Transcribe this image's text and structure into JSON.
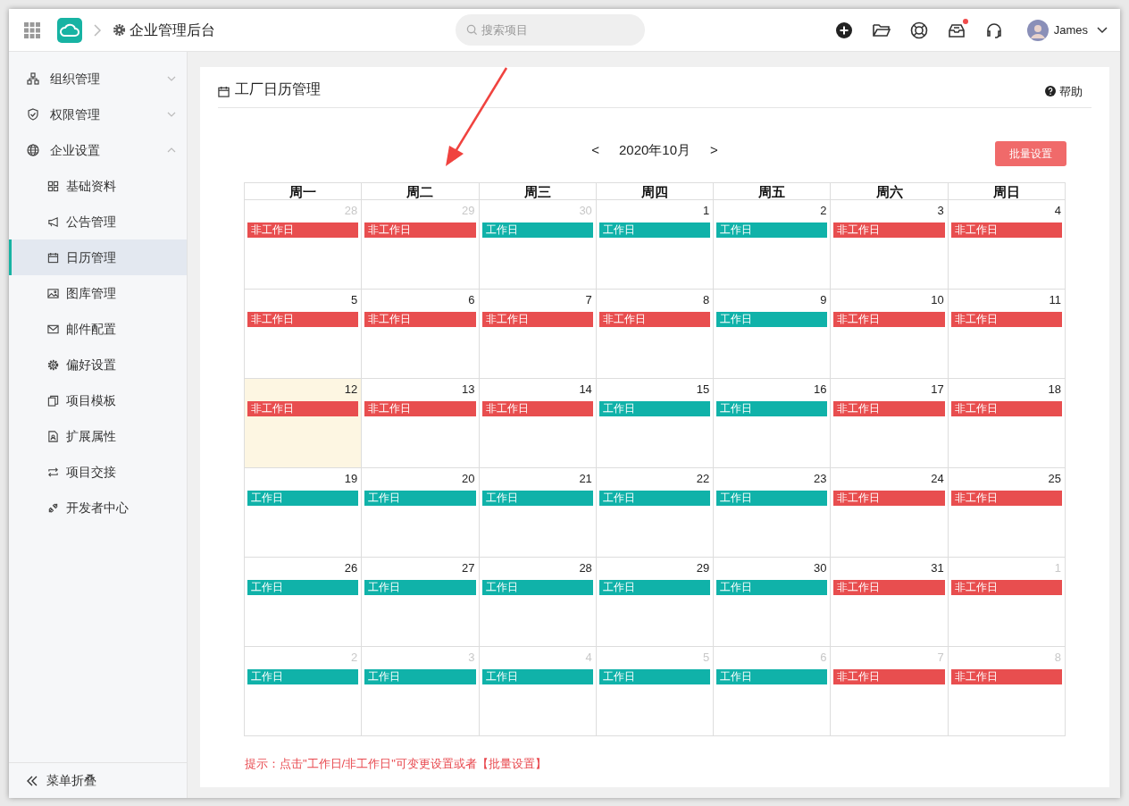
{
  "header": {
    "title": "企业管理后台",
    "search": {
      "placeholder": "搜索项目"
    },
    "user": {
      "name": "James"
    },
    "tools": [
      {
        "kind": "add",
        "badge": false
      },
      {
        "kind": "folder",
        "badge": false
      },
      {
        "kind": "lifebuoy",
        "badge": false
      },
      {
        "kind": "inbox",
        "badge": true
      },
      {
        "kind": "headset",
        "badge": false
      }
    ]
  },
  "sidebar": {
    "items": [
      {
        "label": "组织管理",
        "kind": "org",
        "expanded": false
      },
      {
        "label": "权限管理",
        "kind": "shield",
        "expanded": false
      },
      {
        "label": "企业设置",
        "kind": "globe",
        "expanded": true,
        "children": [
          {
            "label": "基础资料",
            "kind": "grid",
            "selected": false
          },
          {
            "label": "公告管理",
            "kind": "megaphone",
            "selected": false
          },
          {
            "label": "日历管理",
            "kind": "calendar",
            "selected": true
          },
          {
            "label": "图库管理",
            "kind": "image",
            "selected": false
          },
          {
            "label": "邮件配置",
            "kind": "mail",
            "selected": false
          },
          {
            "label": "偏好设置",
            "kind": "gear",
            "selected": false
          },
          {
            "label": "项目模板",
            "kind": "copy",
            "selected": false
          },
          {
            "label": "扩展属性",
            "kind": "doc",
            "selected": false
          },
          {
            "label": "项目交接",
            "kind": "swap",
            "selected": false
          },
          {
            "label": "开发者中心",
            "kind": "plug",
            "selected": false
          }
        ]
      }
    ],
    "collapse": "菜单折叠"
  },
  "page": {
    "title": "工厂日历管理",
    "help": "帮助",
    "prev": "<",
    "month": "2020年10月",
    "next": ">",
    "batch_button": "批量设置",
    "weekdays": [
      "周一",
      "周二",
      "周三",
      "周四",
      "周五",
      "周六",
      "周日"
    ],
    "weeks": [
      [
        {
          "day": "28",
          "muted": true,
          "today": false,
          "kind": "off",
          "label": "非工作日"
        },
        {
          "day": "29",
          "muted": true,
          "today": false,
          "kind": "off",
          "label": "非工作日"
        },
        {
          "day": "30",
          "muted": true,
          "today": false,
          "kind": "work",
          "label": "工作日"
        },
        {
          "day": "1",
          "muted": false,
          "today": false,
          "kind": "work",
          "label": "工作日"
        },
        {
          "day": "2",
          "muted": false,
          "today": false,
          "kind": "work",
          "label": "工作日"
        },
        {
          "day": "3",
          "muted": false,
          "today": false,
          "kind": "off",
          "label": "非工作日"
        },
        {
          "day": "4",
          "muted": false,
          "today": false,
          "kind": "off",
          "label": "非工作日"
        }
      ],
      [
        {
          "day": "5",
          "muted": false,
          "today": false,
          "kind": "off",
          "label": "非工作日"
        },
        {
          "day": "6",
          "muted": false,
          "today": false,
          "kind": "off",
          "label": "非工作日"
        },
        {
          "day": "7",
          "muted": false,
          "today": false,
          "kind": "off",
          "label": "非工作日"
        },
        {
          "day": "8",
          "muted": false,
          "today": false,
          "kind": "off",
          "label": "非工作日"
        },
        {
          "day": "9",
          "muted": false,
          "today": false,
          "kind": "work",
          "label": "工作日"
        },
        {
          "day": "10",
          "muted": false,
          "today": false,
          "kind": "off",
          "label": "非工作日"
        },
        {
          "day": "11",
          "muted": false,
          "today": false,
          "kind": "off",
          "label": "非工作日"
        }
      ],
      [
        {
          "day": "12",
          "muted": false,
          "today": true,
          "kind": "off",
          "label": "非工作日"
        },
        {
          "day": "13",
          "muted": false,
          "today": false,
          "kind": "off",
          "label": "非工作日"
        },
        {
          "day": "14",
          "muted": false,
          "today": false,
          "kind": "off",
          "label": "非工作日"
        },
        {
          "day": "15",
          "muted": false,
          "today": false,
          "kind": "work",
          "label": "工作日"
        },
        {
          "day": "16",
          "muted": false,
          "today": false,
          "kind": "work",
          "label": "工作日"
        },
        {
          "day": "17",
          "muted": false,
          "today": false,
          "kind": "off",
          "label": "非工作日"
        },
        {
          "day": "18",
          "muted": false,
          "today": false,
          "kind": "off",
          "label": "非工作日"
        }
      ],
      [
        {
          "day": "19",
          "muted": false,
          "today": false,
          "kind": "work",
          "label": "工作日"
        },
        {
          "day": "20",
          "muted": false,
          "today": false,
          "kind": "work",
          "label": "工作日"
        },
        {
          "day": "21",
          "muted": false,
          "today": false,
          "kind": "work",
          "label": "工作日"
        },
        {
          "day": "22",
          "muted": false,
          "today": false,
          "kind": "work",
          "label": "工作日"
        },
        {
          "day": "23",
          "muted": false,
          "today": false,
          "kind": "work",
          "label": "工作日"
        },
        {
          "day": "24",
          "muted": false,
          "today": false,
          "kind": "off",
          "label": "非工作日"
        },
        {
          "day": "25",
          "muted": false,
          "today": false,
          "kind": "off",
          "label": "非工作日"
        }
      ],
      [
        {
          "day": "26",
          "muted": false,
          "today": false,
          "kind": "work",
          "label": "工作日"
        },
        {
          "day": "27",
          "muted": false,
          "today": false,
          "kind": "work",
          "label": "工作日"
        },
        {
          "day": "28",
          "muted": false,
          "today": false,
          "kind": "work",
          "label": "工作日"
        },
        {
          "day": "29",
          "muted": false,
          "today": false,
          "kind": "work",
          "label": "工作日"
        },
        {
          "day": "30",
          "muted": false,
          "today": false,
          "kind": "work",
          "label": "工作日"
        },
        {
          "day": "31",
          "muted": false,
          "today": false,
          "kind": "off",
          "label": "非工作日"
        },
        {
          "day": "1",
          "muted": true,
          "today": false,
          "kind": "off",
          "label": "非工作日"
        }
      ],
      [
        {
          "day": "2",
          "muted": true,
          "today": false,
          "kind": "work",
          "label": "工作日"
        },
        {
          "day": "3",
          "muted": true,
          "today": false,
          "kind": "work",
          "label": "工作日"
        },
        {
          "day": "4",
          "muted": true,
          "today": false,
          "kind": "work",
          "label": "工作日"
        },
        {
          "day": "5",
          "muted": true,
          "today": false,
          "kind": "work",
          "label": "工作日"
        },
        {
          "day": "6",
          "muted": true,
          "today": false,
          "kind": "work",
          "label": "工作日"
        },
        {
          "day": "7",
          "muted": true,
          "today": false,
          "kind": "off",
          "label": "非工作日"
        },
        {
          "day": "8",
          "muted": true,
          "today": false,
          "kind": "off",
          "label": "非工作日"
        }
      ]
    ],
    "hint": "提示：点击\"工作日/非工作日\"可变更设置或者【批量设置】"
  }
}
